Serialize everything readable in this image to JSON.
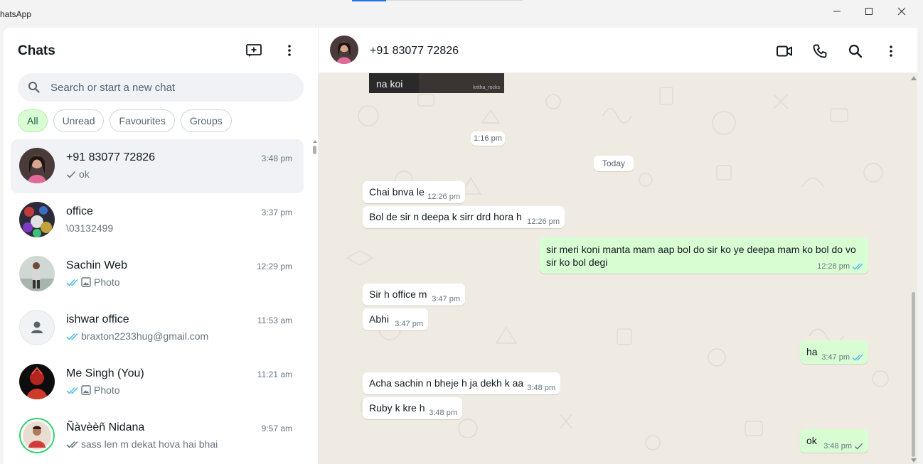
{
  "window": {
    "title": "hatsApp",
    "controls": [
      "minimize-icon",
      "maximize-icon",
      "close-icon"
    ]
  },
  "sidebar": {
    "title": "Chats",
    "search_placeholder": "Search or start a new chat",
    "filters": [
      "All",
      "Unread",
      "Favourites",
      "Groups"
    ],
    "active_filter": "All",
    "chats": [
      {
        "name": "+91 83077 72826",
        "time": "3:48 pm",
        "preview": "ok",
        "status": "sent",
        "media": ""
      },
      {
        "name": "office",
        "time": "3:37 pm",
        "preview": "\\03132499",
        "status": "",
        "media": ""
      },
      {
        "name": "Sachin Web",
        "time": "12:29 pm",
        "preview": "Photo",
        "status": "read",
        "media": "photo-icon"
      },
      {
        "name": "ishwar office",
        "time": "11:53 am",
        "preview": "braxton2233hug@gmail.com",
        "status": "read",
        "media": ""
      },
      {
        "name": "Me Singh (You)",
        "time": "11:21 am",
        "preview": "Photo",
        "status": "read",
        "media": "photo-icon"
      },
      {
        "name": "Ñàvèèñ Nidana",
        "time": "9:57 am",
        "preview": "sass len m dekat hova hai bhai",
        "status": "delivered",
        "media": ""
      }
    ]
  },
  "conversation": {
    "contact": "+91 83077 72826",
    "image_caption": "na koi",
    "image_watermark": "kritha_rocks",
    "timestamp_label": "1:16 pm",
    "date_divider": "Today",
    "messages": [
      {
        "dir": "in",
        "text": "Chai bnva le",
        "time": "12:26 pm"
      },
      {
        "dir": "in",
        "text": "Bol de sir n deepa k sirr drd hora h",
        "time": "12:26 pm"
      },
      {
        "dir": "out",
        "text": "sir meri koni manta mam aap bol do sir ko ye deepa mam ko bol do vo",
        "text2": "sir ko bol degi",
        "time": "12:28 pm",
        "status": "read"
      },
      {
        "dir": "in",
        "text": "Sir h office m",
        "time": "3:47 pm"
      },
      {
        "dir": "in",
        "text": "Abhi",
        "time": "3:47 pm"
      },
      {
        "dir": "out",
        "text": "ha",
        "time": "3:47 pm",
        "status": "read"
      },
      {
        "dir": "in",
        "text": "Acha sachin n bheje h ja dekh k aa",
        "time": "3:48 pm"
      },
      {
        "dir": "in",
        "text": "Ruby k kre h",
        "time": "3:48 pm"
      },
      {
        "dir": "out",
        "text": "ok",
        "time": "3:48 pm",
        "status": "sent"
      }
    ]
  },
  "colors": {
    "accent_green": "#25d366",
    "read_tick": "#53bdeb",
    "outgoing_bubble": "#d9fdd3",
    "chat_background": "#efeae2"
  }
}
